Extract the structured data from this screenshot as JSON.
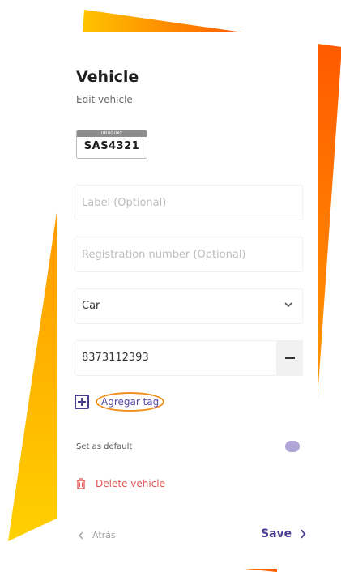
{
  "header": {
    "title": "Vehicle",
    "subtitle": "Edit vehicle"
  },
  "plate": {
    "country": "URUGUAY",
    "number": "SAS4321"
  },
  "form": {
    "label_placeholder": "Label (Optional)",
    "registration_placeholder": "Registration number (Optional)",
    "vehicle_type": "Car",
    "tag_value": "8373112393",
    "add_tag_label": "Agregar tag",
    "set_default_label": "Set as default"
  },
  "actions": {
    "delete_label": "Delete vehicle",
    "back_label": "Atrás",
    "save_label": "Save"
  },
  "colors": {
    "accent": "#4a3c8f",
    "danger": "#e25656",
    "highlight_ring": "#f0901c",
    "toggle": "#b0a6d8",
    "decor_orange": "#ff5a00",
    "decor_yellow": "#ffc400"
  },
  "icons": {
    "dropdown": "chevron-down-icon",
    "remove_tag": "minus-icon",
    "add_tag": "plus-square-icon",
    "delete": "trash-icon",
    "back": "chevron-left-icon",
    "save": "chevron-right-icon"
  }
}
